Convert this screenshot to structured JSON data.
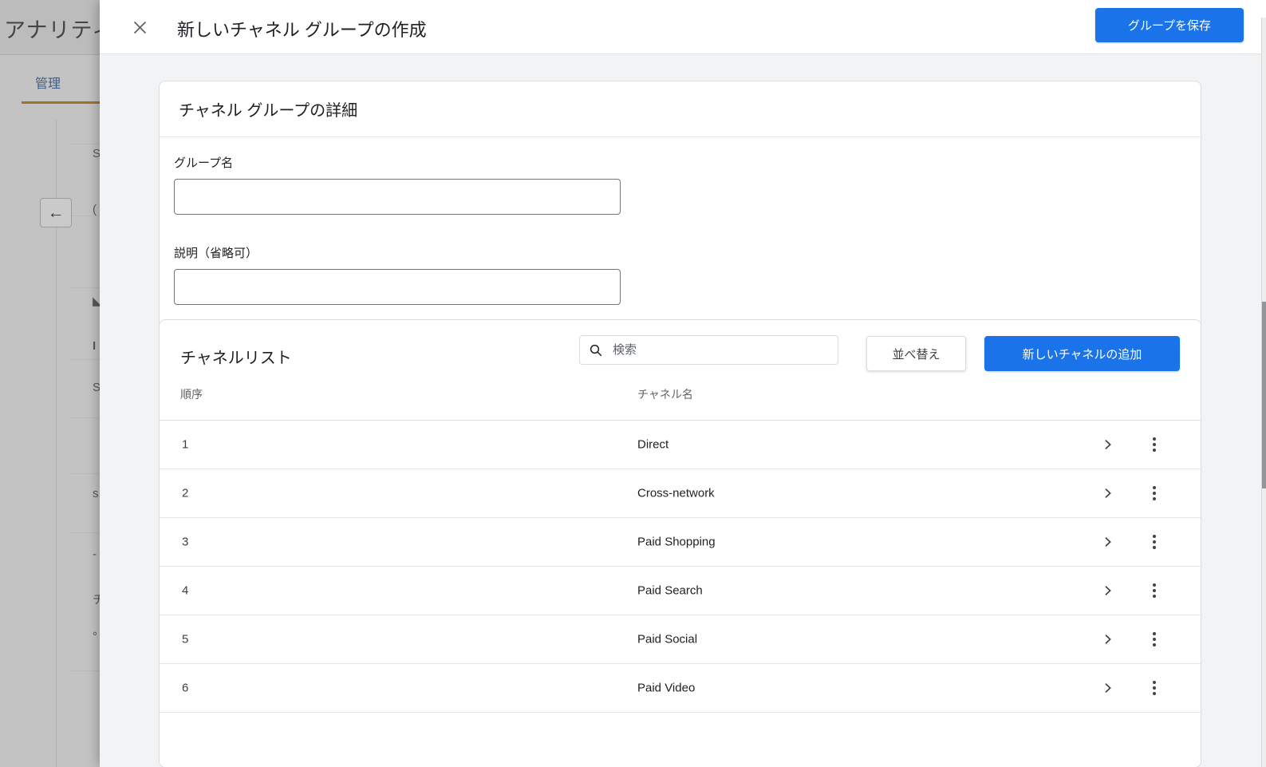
{
  "colors": {
    "primary_blue": "#1a73e8",
    "tab_blue": "#44618c",
    "tab_underline_orange": "#a87a2b",
    "text_dark": "#202124",
    "text_secondary": "#5f6368"
  },
  "background": {
    "app_title": "アナリティ",
    "tab_label": "管理",
    "back_arrow": "←",
    "fragments": [
      "S",
      "(",
      "◣",
      "I",
      "S",
      "s",
      "-",
      "チ",
      "°"
    ]
  },
  "modal": {
    "title": "新しいチャネル グループの作成",
    "save_button": "グループを保存"
  },
  "details_card": {
    "title": "チャネル グループの詳細",
    "group_name_label": "グループ名",
    "group_name_value": "",
    "description_label": "説明（省略可）",
    "description_value": ""
  },
  "channel_card": {
    "title": "チャネルリスト",
    "search_placeholder": "検索",
    "sort_button": "並べ替え",
    "add_button": "新しいチャネルの追加",
    "columns": {
      "order": "順序",
      "name": "チャネル名"
    },
    "rows": [
      {
        "order": "1",
        "name": "Direct"
      },
      {
        "order": "2",
        "name": "Cross-network"
      },
      {
        "order": "3",
        "name": "Paid Shopping"
      },
      {
        "order": "4",
        "name": "Paid Search"
      },
      {
        "order": "5",
        "name": "Paid Social"
      },
      {
        "order": "6",
        "name": "Paid Video"
      }
    ]
  }
}
